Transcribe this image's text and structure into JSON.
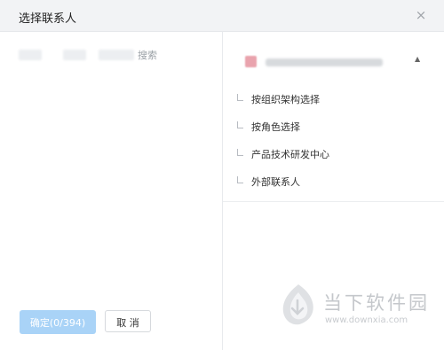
{
  "dialog": {
    "title": "选择联系人",
    "close_symbol": "×"
  },
  "left": {
    "search_hint_suffix": "搜索",
    "confirm_label": "确定(0/394)",
    "cancel_label": "取 消"
  },
  "right": {
    "org_caret": "▲",
    "tree_items": [
      "按组织架构选择",
      "按角色选择",
      "产品技术研发中心",
      "外部联系人"
    ]
  },
  "watermark": {
    "brand_text": "当下软件园",
    "url_text": "www.downxia.com"
  },
  "colors": {
    "primary_disabled": "#a9d3f7",
    "header_bg": "#f2f3f5",
    "org_badge": "#e9a3ad"
  }
}
